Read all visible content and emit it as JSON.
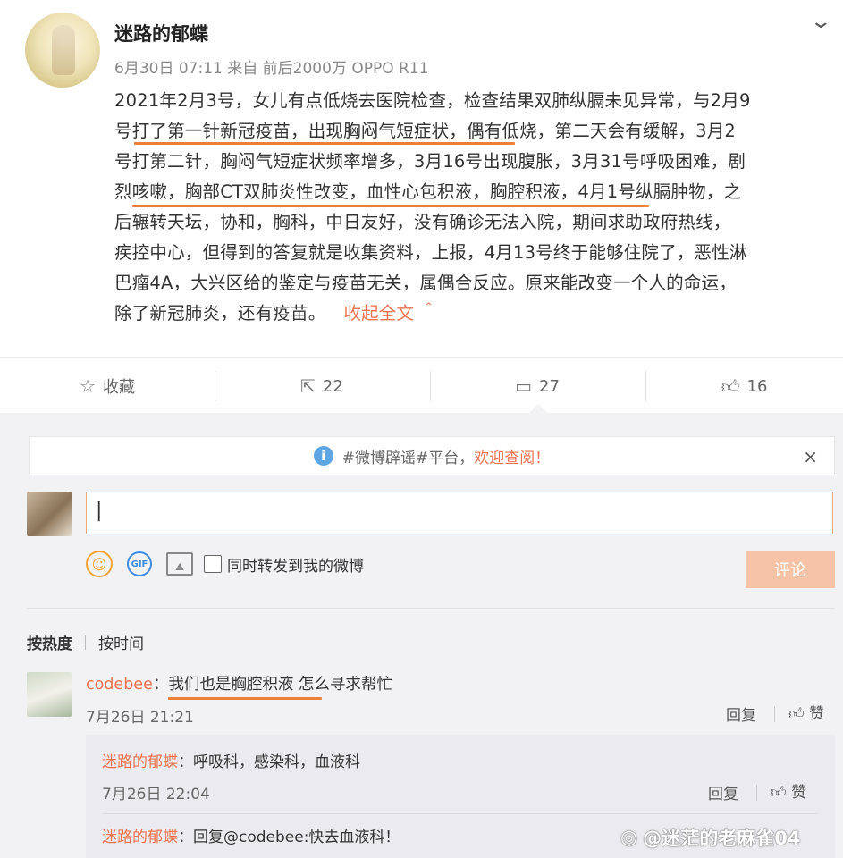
{
  "post": {
    "author": "迷路的郁蝶",
    "meta": "6月30日 07:11 来自 前后2000万 OPPO R11",
    "lines": [
      "2021年2月3号，女儿有点低烧去医院检查，检查结果双肺纵膈未见异常，与2月9",
      "号打了第一针新冠疫苗，出现胸闷气短症状，偶有低烧，第二天会有缓解，3月2",
      "号打第二针，胸闷气短症状频率增多，3月16号出现腹胀，3月31号呼吸困难，剧",
      "烈咳嗽，胸部CT双肺炎性改变，血性心包积液，胸腔积液，4月1号纵膈肿物，之",
      "后辗转天坛，协和，胸科，中日友好，没有确诊无法入院，期间求助政府热线，",
      "疾控中心，但得到的答复就是收集资料，上报，4月13号终于能够住院了，恶性淋",
      "巴瘤4A，大兴区给的鉴定与疫苗无关，属偶合反应。原来能改变一个人的命运，",
      "除了新冠肺炎，还有疫苗。"
    ],
    "collapse_label": "收起全文 ＾"
  },
  "actions": {
    "favorite": "收藏",
    "repost": "22",
    "comment": "27",
    "like": "16"
  },
  "notice": {
    "text": "#微博辟谣#平台，",
    "welcome": "欢迎查阅！",
    "close": "×"
  },
  "composer": {
    "value": "|",
    "sync_label": "同时转发到我的微博",
    "submit": "评论"
  },
  "sort": {
    "hot": "按热度",
    "time": "按时间"
  },
  "comments": [
    {
      "name": "codebee",
      "text": "：我们也是胸腔积液 怎么寻求帮忙",
      "time": "7月26日 21:21",
      "reply": "回复",
      "like": "赞",
      "replies": [
        {
          "name": "迷路的郁蝶",
          "text": "：呼吸科，感染科，血液科",
          "time": "7月26日 22:04",
          "reply": "回复",
          "like": "赞"
        },
        {
          "name": "迷路的郁蝶",
          "text": "：回复@codebee:快去血液科！"
        }
      ]
    }
  ],
  "watermark": "@迷茫的老麻雀04",
  "colors": {
    "accent": "#eb7350",
    "underline": "#ec7f3a",
    "submit_bg": "#f7c3a6",
    "panel_bg": "#f2f2f5"
  }
}
